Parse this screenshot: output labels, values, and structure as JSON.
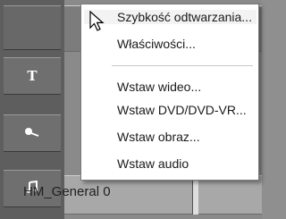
{
  "context_menu": {
    "items": [
      {
        "label": "Szybkość odtwarzania..."
      },
      {
        "label": "Właściwości..."
      },
      {
        "label": "Wstaw wideo..."
      },
      {
        "label": "Wstaw DVD/DVD-VR..."
      },
      {
        "label": "Wstaw obraz..."
      },
      {
        "label": "Wstaw audio"
      }
    ]
  },
  "tracks": {
    "icons": [
      "text-track-icon",
      "voice-track-icon",
      "music-track-icon"
    ],
    "clip_label": "HM_General 0"
  }
}
